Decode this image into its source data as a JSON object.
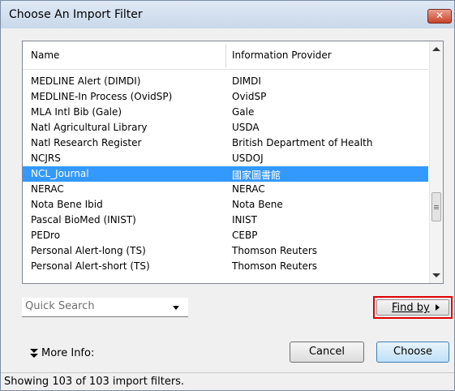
{
  "window": {
    "title": "Choose An Import Filter",
    "close_label": "✕"
  },
  "list": {
    "columns": [
      "Name",
      "Information Provider"
    ],
    "rows": [
      {
        "name": "MEDLINE Alert (DIMDI)",
        "provider": "DIMDI"
      },
      {
        "name": "MEDLINE-In Process (OvidSP)",
        "provider": "OvidSP"
      },
      {
        "name": "MLA Intl Bib (Gale)",
        "provider": "Gale"
      },
      {
        "name": "Natl Agricultural Library",
        "provider": "USDA"
      },
      {
        "name": "Natl Research Register",
        "provider": "British Department of Health"
      },
      {
        "name": "NCJRS",
        "provider": "USDOJ"
      },
      {
        "name": "NCL_Journal",
        "provider": "國家圖書館",
        "selected": true
      },
      {
        "name": "NERAC",
        "provider": "NERAC"
      },
      {
        "name": "Nota Bene Ibid",
        "provider": "Nota Bene"
      },
      {
        "name": "Pascal BioMed (INIST)",
        "provider": "INIST"
      },
      {
        "name": "PEDro",
        "provider": "CEBP"
      },
      {
        "name": "Personal Alert-long (TS)",
        "provider": "Thomson Reuters"
      },
      {
        "name": "Personal Alert-short (TS)",
        "provider": "Thomson Reuters"
      }
    ]
  },
  "search": {
    "placeholder": "Quick Search"
  },
  "find_by": {
    "label": "Find by"
  },
  "more_info": {
    "label": "More Info:"
  },
  "buttons": {
    "cancel": "Cancel",
    "choose": "Choose"
  },
  "status": {
    "text": "Showing 103 of 103 import filters."
  },
  "colors": {
    "selection": "#3399ff",
    "highlight_box": "#e00000"
  }
}
